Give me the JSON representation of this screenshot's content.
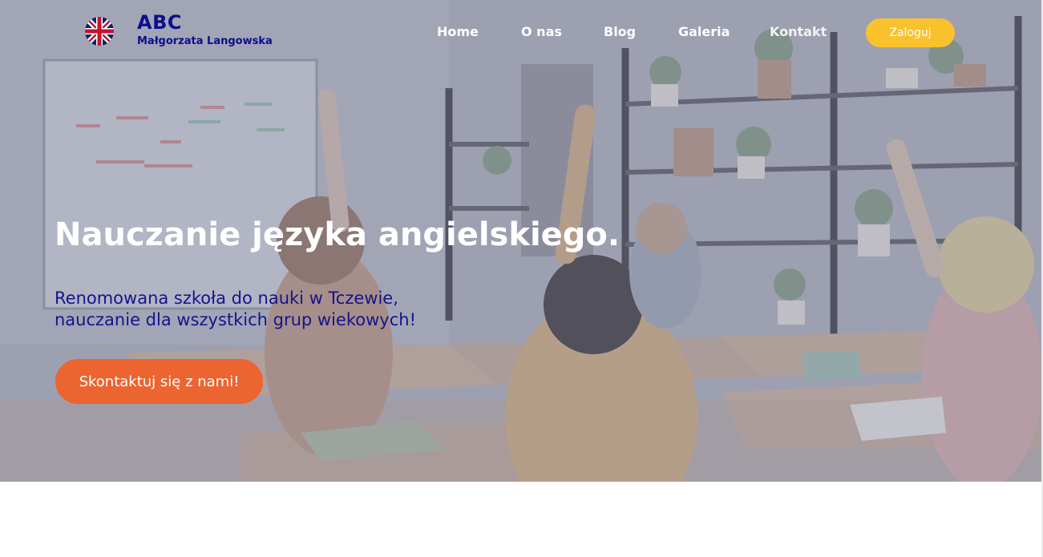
{
  "header": {
    "logo_title": "ABC",
    "logo_subtitle": "Małgorzata Langowska",
    "logo_icon": "uk-flag-icon",
    "nav": [
      {
        "label": "Home"
      },
      {
        "label": "O nas"
      },
      {
        "label": "Blog"
      },
      {
        "label": "Galeria"
      },
      {
        "label": "Kontakt"
      }
    ],
    "login_label": "Zaloguj"
  },
  "hero": {
    "title": "Nauczanie języka angielskiego.",
    "text_line1": "Renomowana szkoła do nauki w Tczewie,",
    "text_line2": "nauczanie dla wszystkich grup wiekowych!",
    "cta_label": "Skontaktuj się z nami!",
    "background_image": "classroom-photo"
  },
  "colors": {
    "brand_navy": "#0c0e8c",
    "accent_yellow": "#f9c22c",
    "cta_orange": "#ec6430",
    "nav_text": "#ffffff"
  }
}
